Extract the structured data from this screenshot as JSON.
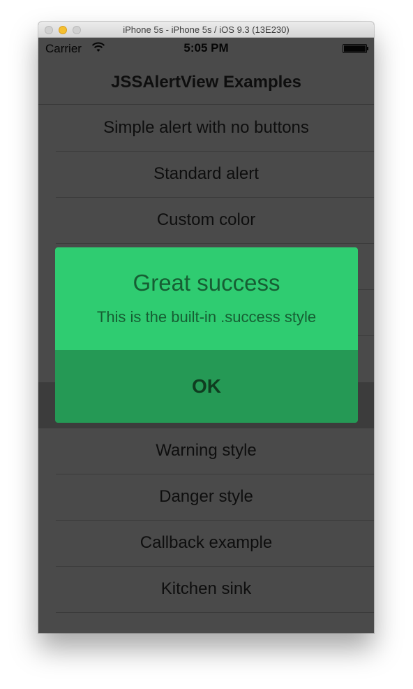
{
  "window": {
    "title": "iPhone 5s - iPhone 5s / iOS 9.3 (13E230)"
  },
  "statusbar": {
    "carrier": "Carrier",
    "time": "5:05 PM"
  },
  "navbar": {
    "title": "JSSAlertView Examples"
  },
  "list": {
    "items": [
      {
        "label": "Simple alert with no buttons"
      },
      {
        "label": "Standard alert"
      },
      {
        "label": "Custom color"
      },
      {
        "label": ""
      },
      {
        "label": ""
      },
      {
        "label": ""
      },
      {
        "label": ""
      },
      {
        "label": "Warning style"
      },
      {
        "label": "Danger style"
      },
      {
        "label": "Callback example"
      },
      {
        "label": "Kitchen sink"
      }
    ]
  },
  "alert": {
    "title": "Great success",
    "message": "This is the built-in .success style",
    "button_label": "OK",
    "colors": {
      "top": "#2fcc71",
      "button": "#259955",
      "text": "#165e33"
    }
  }
}
